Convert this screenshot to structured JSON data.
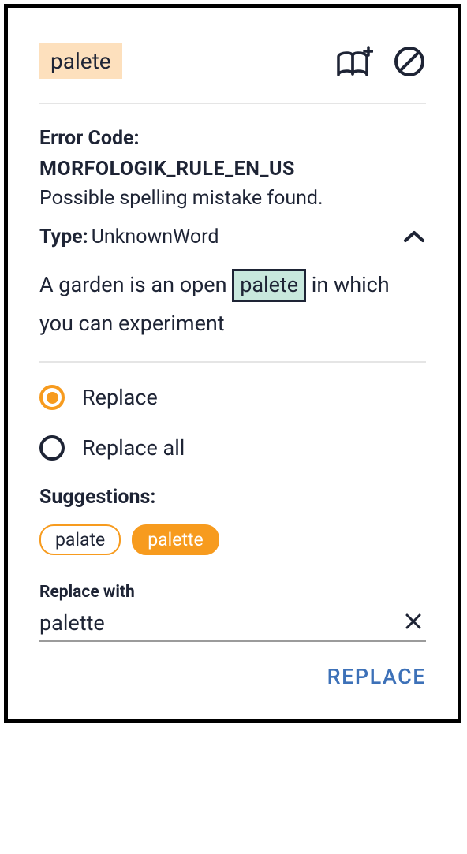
{
  "header": {
    "misspelled_word": "palete"
  },
  "error": {
    "label": "Error Code:",
    "code": "MORFOLOGIK_RULE_EN_US",
    "description": "Possible spelling mistake found.",
    "type_label": "Type:",
    "type_value": "UnknownWord"
  },
  "context": {
    "before": "A garden is an open ",
    "highlighted": "palete",
    "after": " in which you can experiment"
  },
  "radios": {
    "replace": "Replace",
    "replace_all": "Replace all"
  },
  "suggestions": {
    "label": "Suggestions:",
    "items": [
      "palate",
      "palette"
    ],
    "selected_index": 1
  },
  "replace_with": {
    "label": "Replace with",
    "value": "palette"
  },
  "actions": {
    "replace": "REPLACE"
  }
}
